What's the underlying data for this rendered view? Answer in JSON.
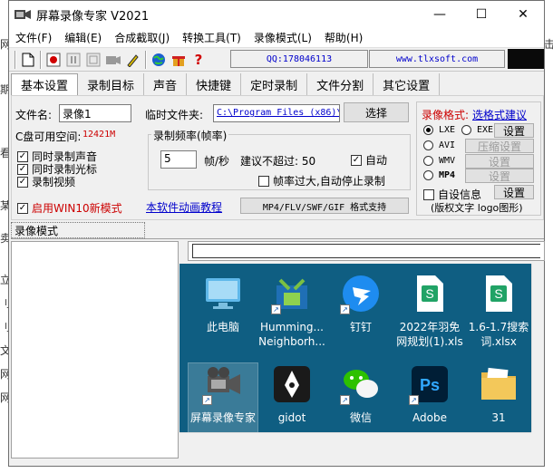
{
  "background_chars": [
    "网",
    "期",
    "看",
    "某",
    "卖",
    "立",
    "刂",
    "刂",
    "文",
    "网",
    "网"
  ],
  "background_right": "击",
  "window": {
    "title": "屏幕录像专家 V2021",
    "controls": {
      "minimize": "—",
      "maximize": "☐",
      "close": "✕"
    }
  },
  "menu": [
    "文件(F)",
    "编辑(E)",
    "合成截取(J)",
    "转换工具(T)",
    "录像模式(L)",
    "帮助(H)"
  ],
  "toolbar": {
    "qq": "QQ:178046113",
    "website": "www.tlxsoft.com"
  },
  "tabs": [
    "基本设置",
    "录制目标",
    "声音",
    "快捷键",
    "定时录制",
    "文件分割",
    "其它设置"
  ],
  "basic": {
    "filename_label": "文件名:",
    "filename_value": "录像1",
    "tempdir_label": "临时文件夹:",
    "tempdir_value": "C:\\Program Files (x86)\\",
    "select_button": "选择",
    "disk_label": "C盘可用空间:",
    "disk_value": "12421M",
    "check_record_sound": "同时录制声音",
    "check_record_cursor": "同时录制光标",
    "check_record_video": "录制视频",
    "check_win10": "启用WIN10新模式",
    "framerate_group": "录制频率(帧率)",
    "framerate_value": "5",
    "framerate_unit": "帧/秒",
    "framerate_suggest": "建议不超过: 50",
    "auto_label": "自动",
    "auto_stop_label": "帧率过大,自动停止录制",
    "tutorial_link": "本软件动画教程",
    "formats_button": "MP4/FLV/SWF/GIF  格式支持"
  },
  "format": {
    "title": "录像格式:",
    "suggest_link": "选格式建议",
    "options": [
      "LXE",
      "EXE",
      "AVI",
      "WMV",
      "MP4"
    ],
    "selected": "LXE",
    "settings_btn": "设置",
    "compress_btn": "压缩设置",
    "custom_info": "自设信息",
    "custom_info_btn": "设置",
    "copyright_note": "(版权文字 logo图形)"
  },
  "mode_bar": {
    "label": "录像模式"
  },
  "desktop_icons": [
    {
      "label_line1": "此电脑",
      "label_line2": "",
      "icon": "computer-icon"
    },
    {
      "label_line1": "Humming...",
      "label_line2": "Neighborh...",
      "icon": "hummingbird-icon"
    },
    {
      "label_line1": "钉钉",
      "label_line2": "",
      "icon": "dingtalk-icon"
    },
    {
      "label_line1": "2022年羽免",
      "label_line2": "网规划(1).xls",
      "icon": "excel-file-icon"
    },
    {
      "label_line1": "1.6-1.7搜索",
      "label_line2": "词.xlsx",
      "icon": "excel-file-icon"
    },
    {
      "label_line1": "屏幕录像专家",
      "label_line2": "",
      "icon": "screen-recorder-icon"
    },
    {
      "label_line1": "gidot",
      "label_line2": "",
      "icon": "pen-nib-icon"
    },
    {
      "label_line1": "微信",
      "label_line2": "",
      "icon": "wechat-icon"
    },
    {
      "label_line1": "Adobe",
      "label_line2": "",
      "icon": "photoshop-icon"
    },
    {
      "label_line1": "31",
      "label_line2": "",
      "icon": "folder-icon"
    }
  ],
  "colors": {
    "desktop_bg": "#0f5e82",
    "link": "#0000cc",
    "accent_red": "#cc0000"
  }
}
